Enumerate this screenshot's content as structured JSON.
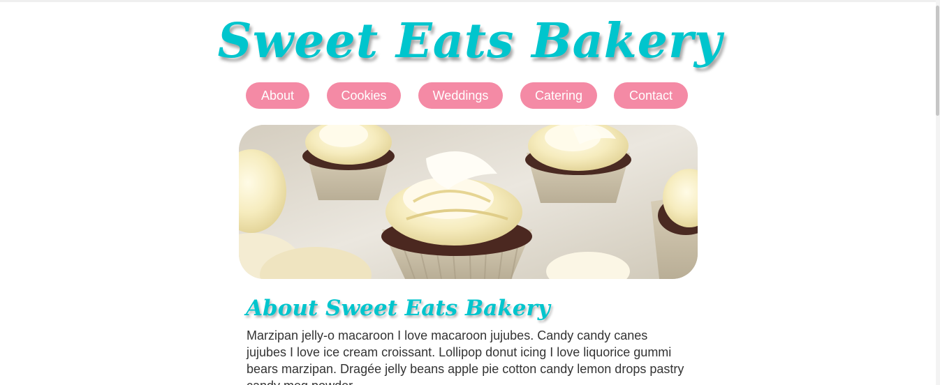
{
  "site": {
    "title": "Sweet Eats Bakery"
  },
  "nav": {
    "items": [
      {
        "label": "About"
      },
      {
        "label": "Cookies"
      },
      {
        "label": "Weddings"
      },
      {
        "label": "Catering"
      },
      {
        "label": "Contact"
      }
    ]
  },
  "hero": {
    "image": "cupcakes-photo"
  },
  "about": {
    "heading": "About Sweet Eats Bakery",
    "text": "Marzipan jelly-o macaroon I love macaroon jujubes. Candy candy canes jujubes I love ice cream croissant. Lollipop donut icing I love liquorice gummi bears marzipan. Dragée jelly beans apple pie cotton candy lemon drops pastry candy meg powder"
  },
  "colors": {
    "accent": "#00c5cd",
    "nav_button": "#f48aa5",
    "text": "#333333"
  }
}
